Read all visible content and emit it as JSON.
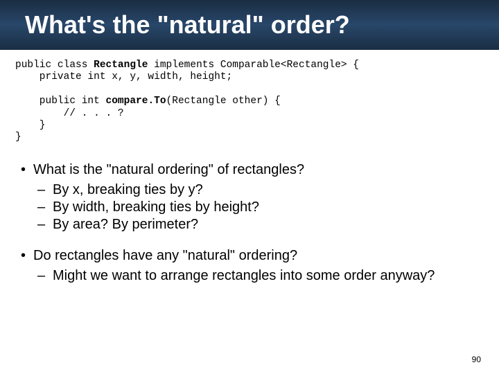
{
  "title": "What's the \"natural\" order?",
  "code": {
    "l1a": "public class ",
    "l1b": "Rectangle",
    "l1c": " implements Comparable<Rectangle> {",
    "l2": "    private int x, y, width, height;",
    "l3": "",
    "l4a": "    public int ",
    "l4b": "compare.To",
    "l4c": "(Rectangle other) {",
    "l5": "        // . . . ?",
    "l6": "    }",
    "l7": "}"
  },
  "bullets": {
    "b1": "What is the \"natural ordering\" of rectangles?",
    "b1_subs": [
      "By x, breaking ties by y?",
      "By width, breaking ties by height?",
      "By area?  By perimeter?"
    ],
    "b2": "Do rectangles have any \"natural\" ordering?",
    "b2_subs": [
      "Might we want to arrange rectangles into some order anyway?"
    ]
  },
  "page_number": "90"
}
